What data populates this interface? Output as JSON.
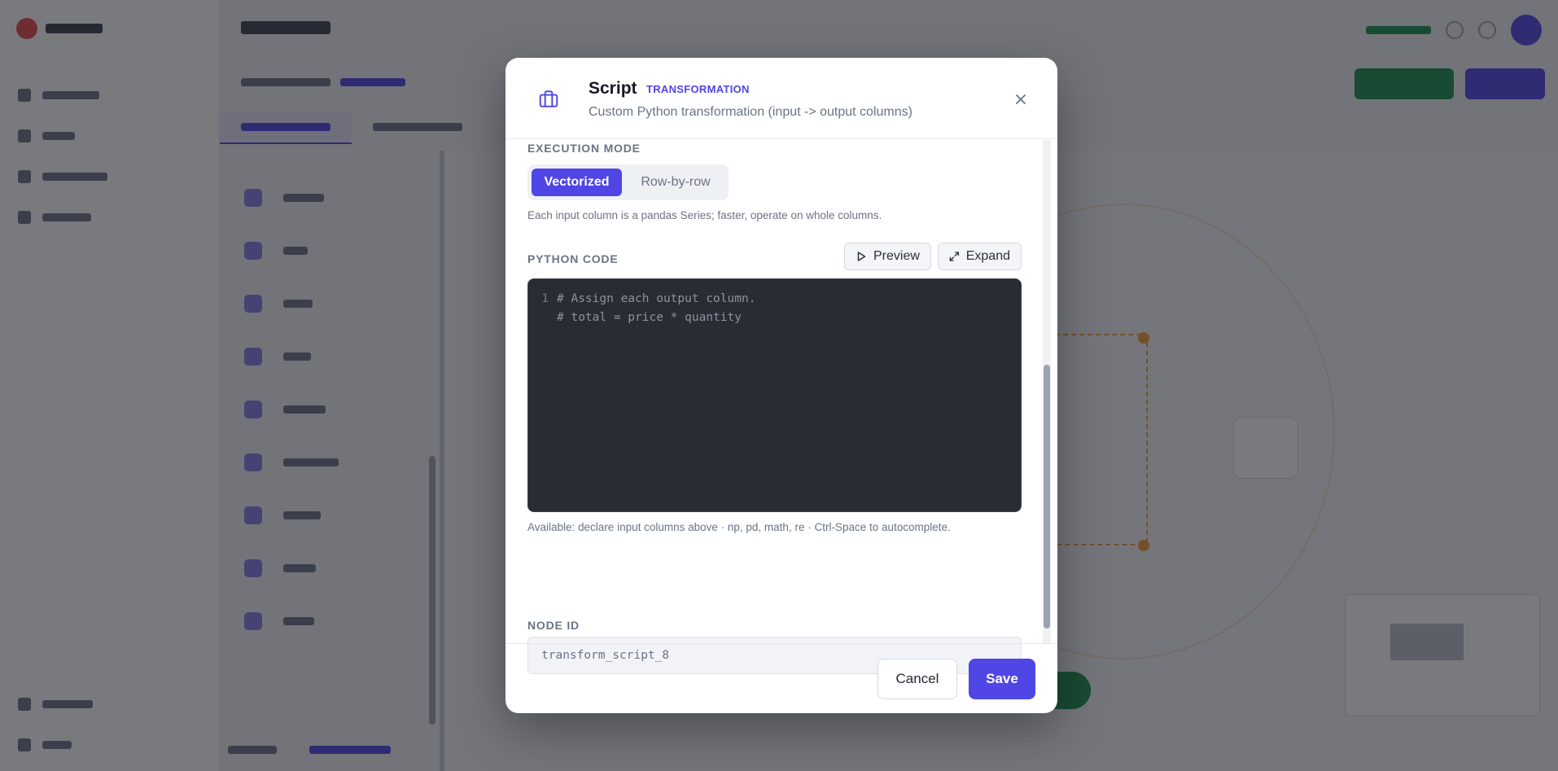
{
  "modal": {
    "title": "Script",
    "badge": "TRANSFORMATION",
    "subtitle": "Custom Python transformation (input -> output columns)",
    "close_icon": "close-icon",
    "header_icon": "briefcase-icon"
  },
  "execution_mode": {
    "label": "EXECUTION MODE",
    "options": [
      "Vectorized",
      "Row-by-row"
    ],
    "selected": "Vectorized",
    "help": "Each input column is a pandas Series; faster, operate on whole columns."
  },
  "python_code": {
    "label": "PYTHON CODE",
    "preview_label": "Preview",
    "expand_label": "Expand",
    "lines": [
      {
        "num": "1",
        "text": "# Assign each output column."
      },
      {
        "num": "",
        "text": "# total = price * quantity"
      }
    ],
    "help": "Available: declare input columns above · np, pd, math, re · Ctrl-Space to autocomplete."
  },
  "node_id": {
    "label": "NODE ID",
    "placeholder": "transform_script_8"
  },
  "footer": {
    "cancel_label": "Cancel",
    "save_label": "Save"
  },
  "colors": {
    "accent": "#4f46e5",
    "editor_bg": "#282c34",
    "overlay": "#181a20"
  }
}
